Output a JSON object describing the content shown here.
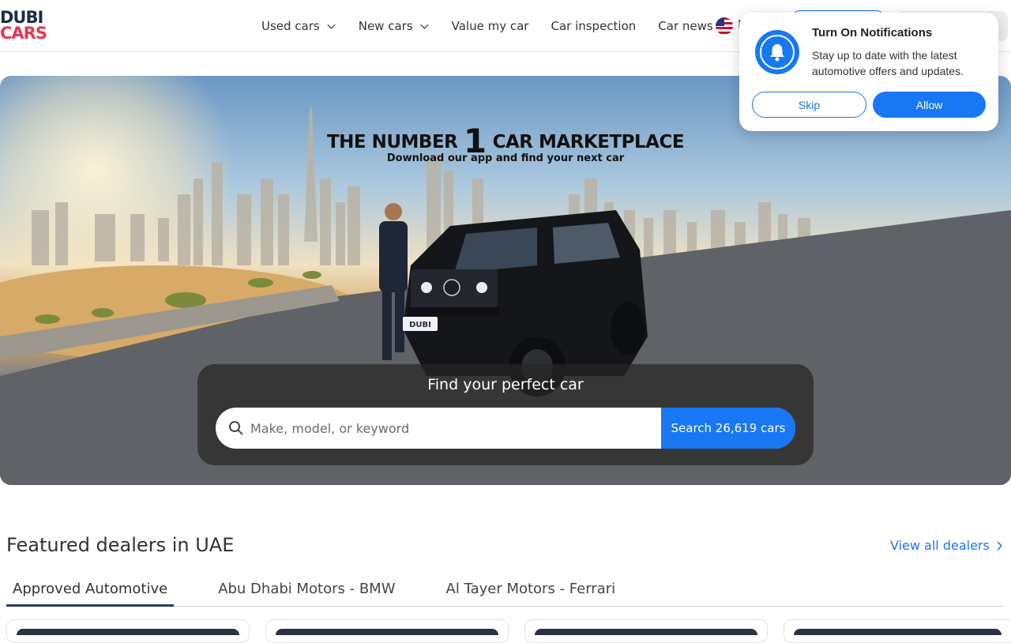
{
  "brand": {
    "line1": "DUBI",
    "line2": "CARS",
    "color_dark": "#1f2a44",
    "color_accent": "#e63650"
  },
  "nav": {
    "items": [
      {
        "label": "Used cars",
        "has_dropdown": true
      },
      {
        "label": "New cars",
        "has_dropdown": true
      },
      {
        "label": "Value my car",
        "has_dropdown": false
      },
      {
        "label": "Car inspection",
        "has_dropdown": false
      },
      {
        "label": "Car news",
        "has_dropdown": false
      }
    ],
    "language_peek": "E",
    "flag_icon": "us-flag-icon"
  },
  "hero": {
    "title_pre": "THE NUMBER ",
    "title_num": "1",
    "title_post": " CAR MARKETPLACE",
    "subtitle": "Download our app and find your next car",
    "plate": "DUBI"
  },
  "search": {
    "title": "Find your perfect car",
    "placeholder": "Make, model, or keyword",
    "button_label": "Search 26,619 cars"
  },
  "featured": {
    "title": "Featured dealers in UAE",
    "view_all": "View all dealers",
    "tabs": [
      {
        "label": "Approved Automotive",
        "active": true
      },
      {
        "label": "Abu Dhabi Motors - BMW",
        "active": false
      },
      {
        "label": "Al Tayer Motors - Ferrari",
        "active": false
      }
    ]
  },
  "notification": {
    "title": "Turn On Notifications",
    "text": "Stay up to date with the latest automotive offers and updates.",
    "skip_label": "Skip",
    "allow_label": "Allow",
    "icon": "bell-icon"
  },
  "colors": {
    "primary": "#1877f2",
    "text": "#333333"
  }
}
